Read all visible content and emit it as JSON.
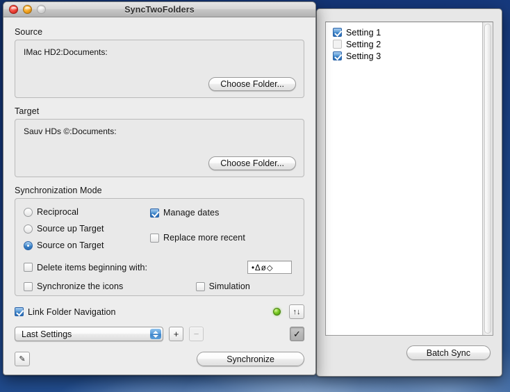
{
  "main_window": {
    "title": "SyncTwoFolders",
    "traffic_lights": {
      "close": "close-button",
      "minimize": "minimize-button",
      "zoom": "zoom-button"
    },
    "source": {
      "label": "Source",
      "path": "IMac HD2:Documents:",
      "choose_button": "Choose Folder..."
    },
    "target": {
      "label": "Target",
      "path": "Sauv HDs ©:Documents:",
      "choose_button": "Choose Folder..."
    },
    "sync_mode": {
      "label": "Synchronization Mode",
      "radios": [
        {
          "label": "Reciprocal",
          "selected": false
        },
        {
          "label": "Source up Target",
          "selected": false
        },
        {
          "label": "Source on Target",
          "selected": true
        }
      ],
      "manage_dates": {
        "label": "Manage dates",
        "checked": true
      },
      "replace_more_recent": {
        "label": "Replace more recent",
        "checked": false
      },
      "delete_items": {
        "label": "Delete items beginning with:",
        "checked": false
      },
      "delete_pattern_value": "•Δø◇",
      "sync_icons": {
        "label": "Synchronize the icons",
        "checked": false
      },
      "simulation": {
        "label": "Simulation",
        "checked": false
      }
    },
    "bottom": {
      "link_folder_navigation": {
        "label": "Link Folder Navigation",
        "checked": true
      },
      "settings_popup_value": "Last Settings",
      "add_button": "+",
      "remove_button": "−",
      "swap_button": "↑↓",
      "confirm_button": "✓",
      "edit_button": "✎",
      "synchronize_button": "Synchronize",
      "status_led": "green"
    }
  },
  "batch_window": {
    "settings": [
      {
        "label": "Setting 1",
        "checked": true
      },
      {
        "label": "Setting 2",
        "checked": false
      },
      {
        "label": "Setting 3",
        "checked": true
      }
    ],
    "batch_sync_button": "Batch Sync"
  },
  "colors": {
    "accent": "#3c82c6",
    "led_green": "#7fcd27",
    "window_bg": "#ededed",
    "desktop": "#1c4489"
  }
}
